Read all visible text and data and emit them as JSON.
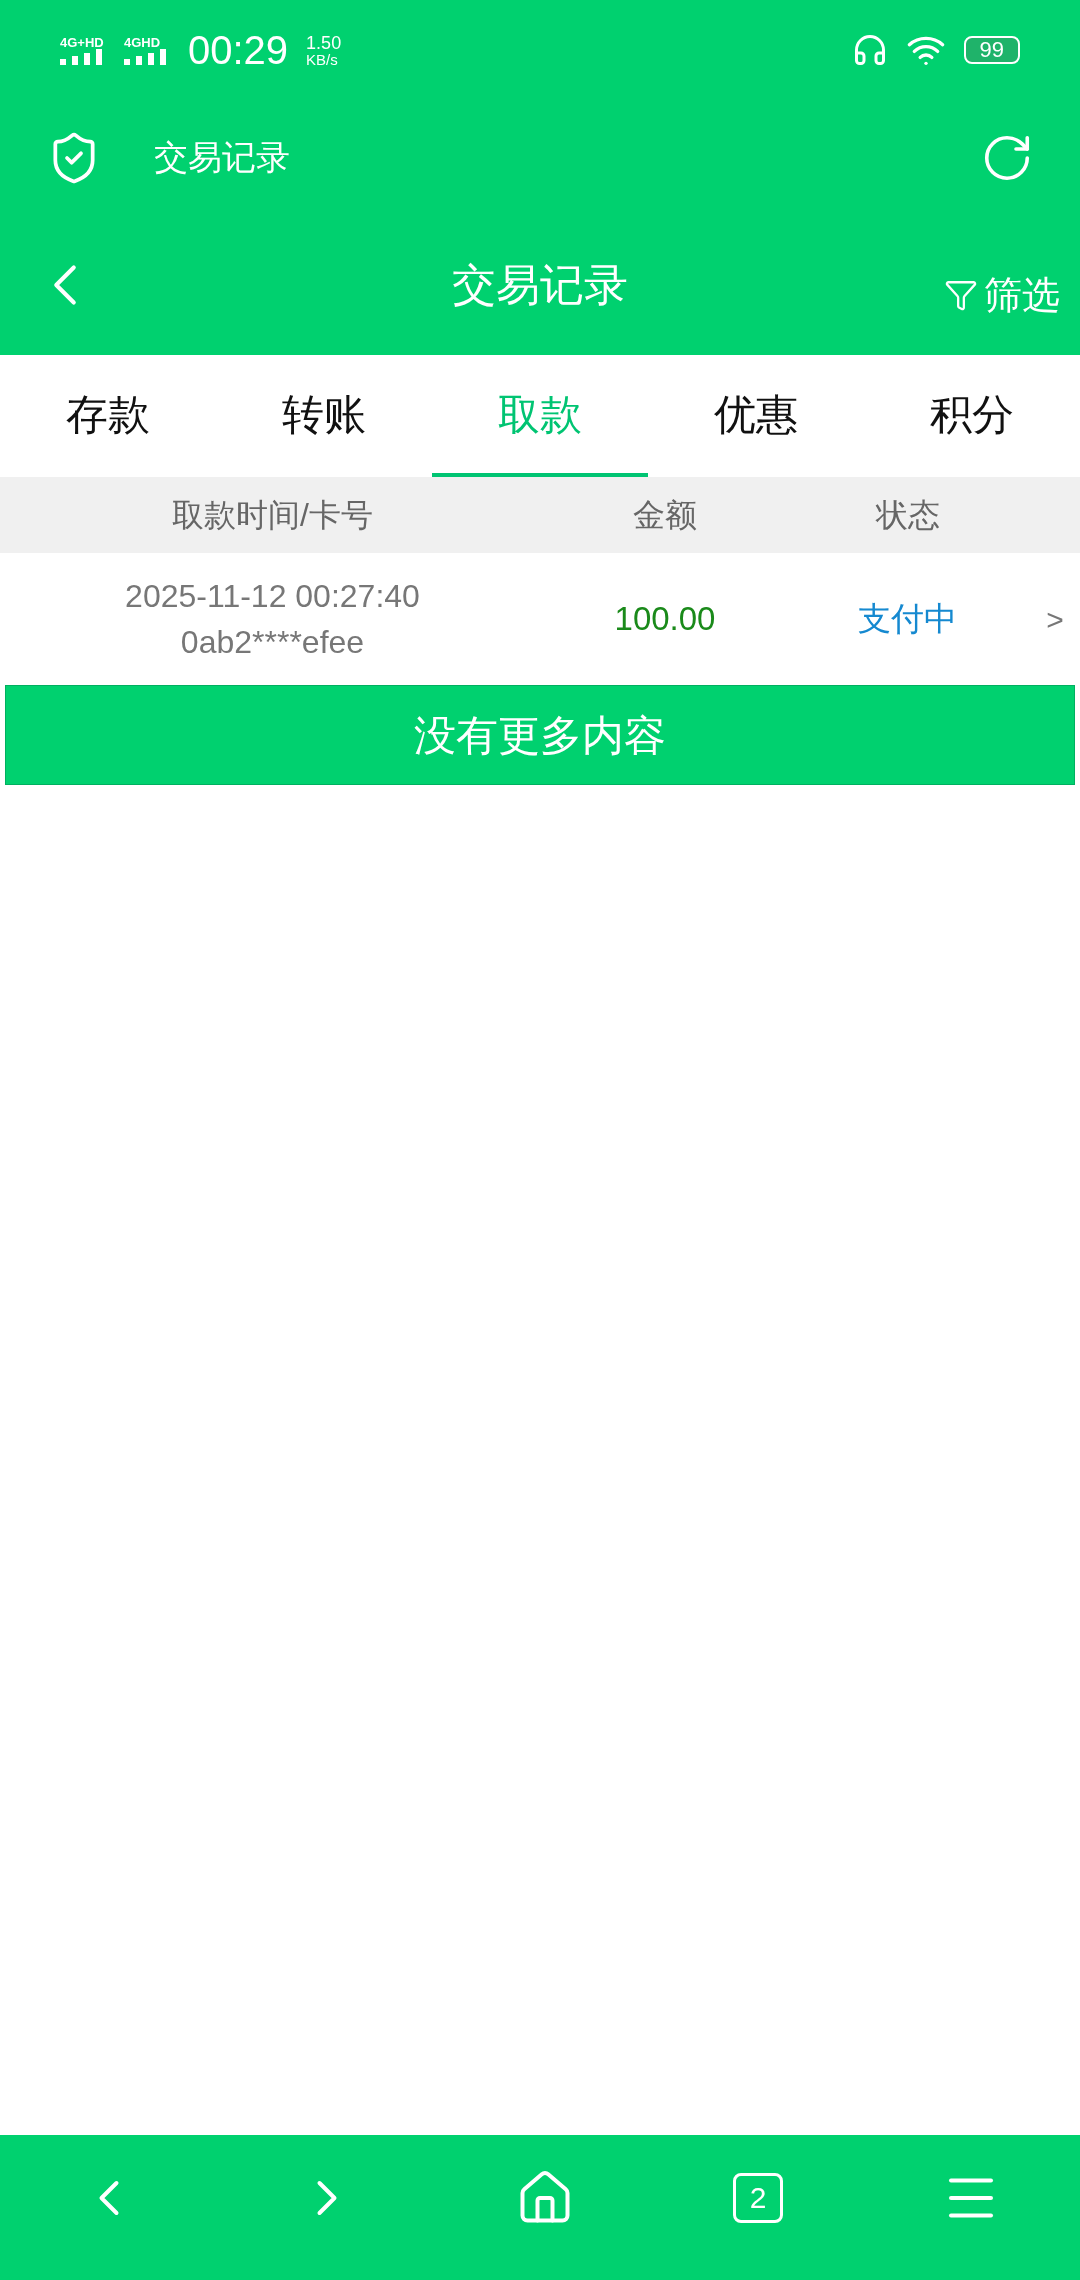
{
  "status_bar": {
    "network_1": "4G+HD",
    "network_2": "4GHD",
    "time": "00:29",
    "speed_value": "1.50",
    "speed_unit": "KB/s",
    "battery": "99"
  },
  "app_bar": {
    "title": "交易记录"
  },
  "nav_bar": {
    "title": "交易记录",
    "filter": "筛选"
  },
  "tabs": [
    {
      "label": "存款",
      "selected": false
    },
    {
      "label": "转账",
      "selected": false
    },
    {
      "label": "取款",
      "selected": true
    },
    {
      "label": "优惠",
      "selected": false
    },
    {
      "label": "积分",
      "selected": false
    }
  ],
  "table": {
    "columns": [
      "取款时间/卡号",
      "金额",
      "状态"
    ],
    "rows": [
      {
        "time": "2025-11-12 00:27:40",
        "card": "0ab2****efee",
        "amount": "100.00",
        "status": "支付中",
        "arrow": ">"
      }
    ]
  },
  "no_more_button": "没有更多内容",
  "bottom_bar": {
    "tab_count": "2"
  }
}
